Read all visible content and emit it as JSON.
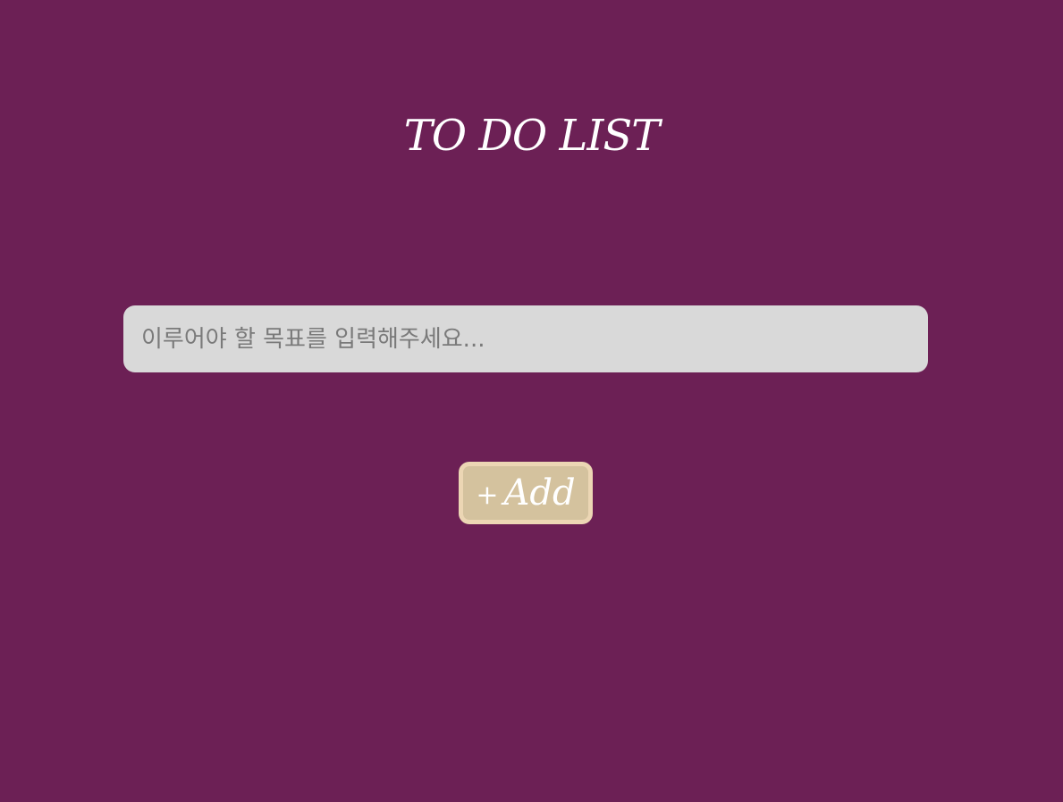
{
  "app": {
    "title": "TO DO LIST",
    "colors": {
      "background": "#6c2055",
      "input_bg": "#d9d9d9",
      "button_bg": "#d4c29e",
      "button_border": "#ecd6b4",
      "title_text": "#ffffff"
    }
  },
  "form": {
    "input": {
      "value": "",
      "placeholder": "이루어야 할 목표를 입력해주세요..."
    },
    "add_button": {
      "icon": "plus-icon",
      "icon_glyph": "+",
      "label": "Add"
    }
  }
}
